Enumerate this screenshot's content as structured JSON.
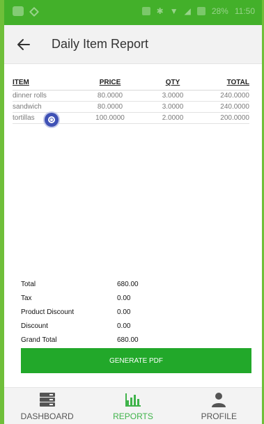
{
  "colors": {
    "accent_green": "#22a82a",
    "statusbar": "#43b02a",
    "active_nav": "#3fb34a"
  },
  "statusbar": {
    "battery_pct": "28%",
    "time": "11:50"
  },
  "appbar": {
    "back_icon": "arrow-left-icon",
    "title": "Daily Item Report"
  },
  "table": {
    "headers": [
      "ITEM",
      "PRICE",
      "QTY",
      "TOTAL"
    ],
    "rows": [
      {
        "item": "dinner rolls",
        "price": "80.0000",
        "qty": "3.0000",
        "total": "240.0000"
      },
      {
        "item": "sandwich",
        "price": "80.0000",
        "qty": "3.0000",
        "total": "240.0000"
      },
      {
        "item": "tortillas",
        "price": "100.0000",
        "qty": "2.0000",
        "total": "200.0000"
      }
    ]
  },
  "summary": [
    {
      "label": "Total",
      "value": "680.00"
    },
    {
      "label": "Tax",
      "value": "0.00"
    },
    {
      "label": "Product Discount",
      "value": "0.00"
    },
    {
      "label": "Discount",
      "value": "0.00"
    },
    {
      "label": "Grand Total",
      "value": "680.00"
    }
  ],
  "generate_button": "GENERATE PDF",
  "nav": [
    {
      "label": "DASHBOARD",
      "icon": "server-stack-icon",
      "active": false
    },
    {
      "label": "REPORTS",
      "icon": "bar-chart-icon",
      "active": true
    },
    {
      "label": "PROFILE",
      "icon": "person-icon",
      "active": false
    }
  ]
}
